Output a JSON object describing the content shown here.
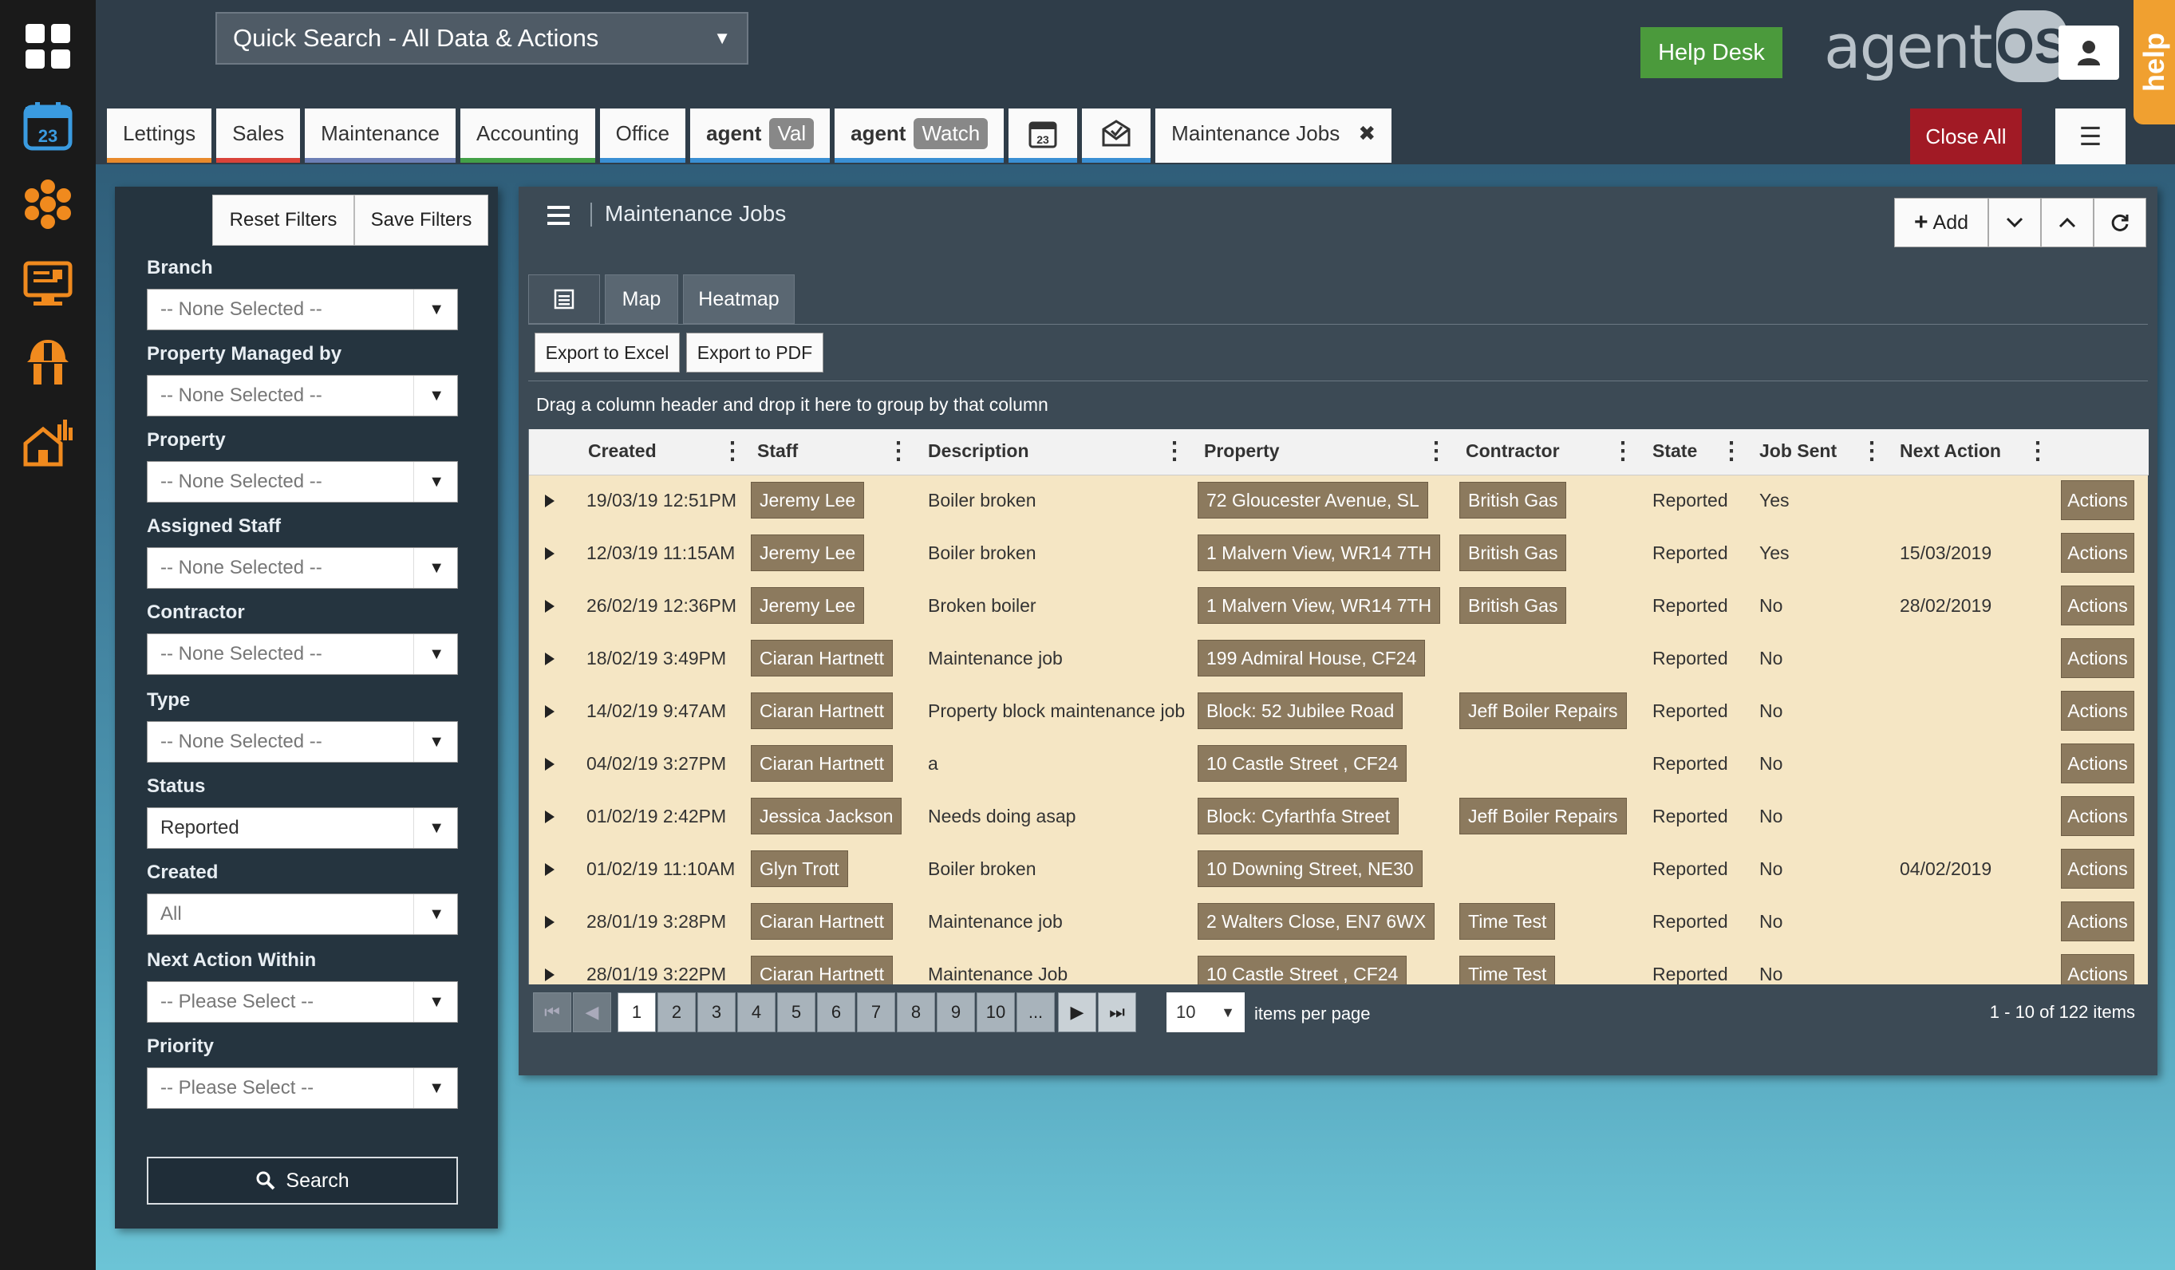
{
  "quick_search": {
    "label": "Quick Search - All Data & Actions"
  },
  "header": {
    "help_desk": "Help Desk",
    "brand_text": "agent",
    "brand_os": "OS",
    "help_tab": "help",
    "calendar_day": "23"
  },
  "tabs": [
    {
      "label": "Lettings"
    },
    {
      "label": "Sales"
    },
    {
      "label": "Maintenance"
    },
    {
      "label": "Accounting"
    },
    {
      "label": "Office"
    },
    {
      "label": "agent",
      "pill": "Val"
    },
    {
      "label": "agent",
      "pill": "Watch"
    }
  ],
  "active_tab": {
    "label": "Maintenance Jobs",
    "close": "✖"
  },
  "close_all": "Close All",
  "filters": {
    "reset": "Reset Filters",
    "save": "Save Filters",
    "fields": [
      {
        "label": "Branch",
        "value": "-- None Selected --"
      },
      {
        "label": "Property Managed by",
        "value": "-- None Selected --"
      },
      {
        "label": "Property",
        "value": "-- None Selected --"
      },
      {
        "label": "Assigned Staff",
        "value": "-- None Selected --"
      },
      {
        "label": "Contractor",
        "value": "-- None Selected --"
      },
      {
        "label": "Type",
        "value": "-- None Selected --"
      },
      {
        "label": "Status",
        "value": "Reported"
      },
      {
        "label": "Created",
        "value": "All"
      },
      {
        "label": "Next Action Within",
        "value": "-- Please Select --"
      },
      {
        "label": "Priority",
        "value": "-- Please Select --"
      }
    ],
    "search": "Search"
  },
  "main": {
    "title": "Maintenance Jobs",
    "add": "Add",
    "view_tabs": {
      "map": "Map",
      "heatmap": "Heatmap"
    },
    "export_excel": "Export to Excel",
    "export_pdf": "Export to PDF",
    "group_hint": "Drag a column header and drop it here to group by that column",
    "columns": [
      "Created",
      "Staff",
      "Description",
      "Property",
      "Contractor",
      "State",
      "Job Sent",
      "Next Action"
    ],
    "rows": [
      {
        "created": "19/03/19 12:51PM",
        "staff": "Jeremy Lee",
        "description": "Boiler broken",
        "property": "72 Gloucester Avenue, SL",
        "contractor": "British Gas",
        "state": "Reported",
        "job_sent": "Yes",
        "next_action": "",
        "actions": "Actions"
      },
      {
        "created": "12/03/19 11:15AM",
        "staff": "Jeremy Lee",
        "description": "Boiler broken",
        "property": "1 Malvern View, WR14 7TH",
        "contractor": "British Gas",
        "state": "Reported",
        "job_sent": "Yes",
        "next_action": "15/03/2019",
        "actions": "Actions"
      },
      {
        "created": "26/02/19 12:36PM",
        "staff": "Jeremy Lee",
        "description": "Broken boiler",
        "property": "1 Malvern View, WR14 7TH",
        "contractor": "British Gas",
        "state": "Reported",
        "job_sent": "No",
        "next_action": "28/02/2019",
        "actions": "Actions"
      },
      {
        "created": "18/02/19 3:49PM",
        "staff": "Ciaran Hartnett",
        "description": "Maintenance job",
        "property": "199 Admiral House, CF24",
        "contractor": "",
        "state": "Reported",
        "job_sent": "No",
        "next_action": "",
        "actions": "Actions"
      },
      {
        "created": "14/02/19 9:47AM",
        "staff": "Ciaran Hartnett",
        "description": "Property block maintenance job",
        "property": "Block: 52 Jubilee Road",
        "contractor": "Jeff Boiler Repairs",
        "state": "Reported",
        "job_sent": "No",
        "next_action": "",
        "actions": "Actions"
      },
      {
        "created": "04/02/19 3:27PM",
        "staff": "Ciaran Hartnett",
        "description": "a",
        "property": "10 Castle Street , CF24",
        "contractor": "",
        "state": "Reported",
        "job_sent": "No",
        "next_action": "",
        "actions": "Actions"
      },
      {
        "created": "01/02/19 2:42PM",
        "staff": "Jessica Jackson",
        "description": "Needs doing asap",
        "property": "Block: Cyfarthfa Street",
        "contractor": "Jeff Boiler Repairs",
        "state": "Reported",
        "job_sent": "No",
        "next_action": "",
        "actions": "Actions"
      },
      {
        "created": "01/02/19 11:10AM",
        "staff": "Glyn Trott",
        "description": "Boiler broken",
        "property": "10 Downing Street, NE30",
        "contractor": "",
        "state": "Reported",
        "job_sent": "No",
        "next_action": "04/02/2019",
        "actions": "Actions"
      },
      {
        "created": "28/01/19 3:28PM",
        "staff": "Ciaran Hartnett",
        "description": "Maintenance job",
        "property": "2 Walters Close, EN7 6WX",
        "contractor": "Time Test",
        "state": "Reported",
        "job_sent": "No",
        "next_action": "",
        "actions": "Actions"
      },
      {
        "created": "28/01/19 3:22PM",
        "staff": "Ciaran Hartnett",
        "description": "Maintenance Job",
        "property": "10 Castle Street , CF24",
        "contractor": "Time Test",
        "state": "Reported",
        "job_sent": "No",
        "next_action": "",
        "actions": "Actions"
      }
    ],
    "pager": {
      "pages": [
        "1",
        "2",
        "3",
        "4",
        "5",
        "6",
        "7",
        "8",
        "9",
        "10",
        "..."
      ],
      "current": "1",
      "per_page": "10",
      "per_page_label": "items per page",
      "summary": "1 - 10 of 122 items"
    }
  }
}
